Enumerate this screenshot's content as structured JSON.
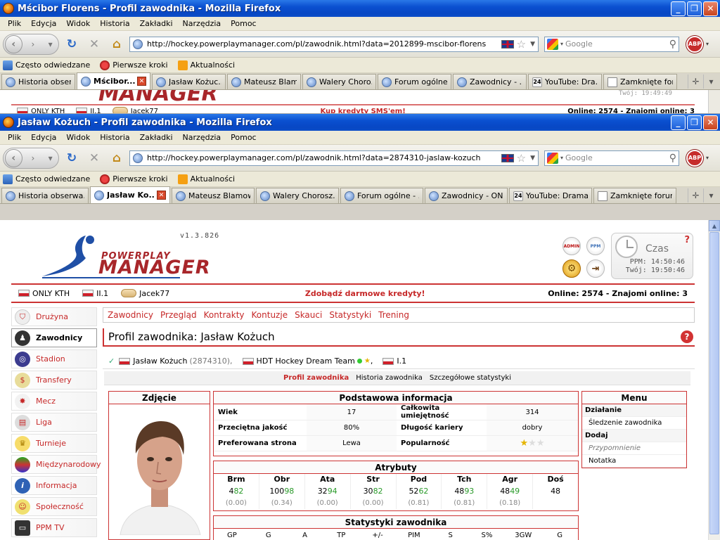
{
  "bg_window": {
    "title": "Mścibor Florens - Profil zawodnika - Mozilla Firefox",
    "url": "http://hockey.powerplaymanager.com/pl/zawodnik.html?data=2012899-mscibor-florens",
    "tabs": [
      "Historia obser...",
      "Mścibor...",
      "Jasław Kożuc...",
      "Mateusz Blam...",
      "Walery Choro...",
      "Forum ogólne...",
      "Zawodnicy - ...",
      "YouTube: Dra...",
      "Zamknięte for..."
    ],
    "strip": {
      "left1": "ONLY KTH",
      "left2": "II.1",
      "left3": "Jacek77",
      "mid": "Kup kredyty SMS'em!",
      "right": "Online: 2574 - Znajomi online: 3",
      "clock_fragment": "Twój: 19:49:49"
    }
  },
  "window": {
    "title": "Jasław Kożuch - Profil zawodnika - Mozilla Firefox",
    "menu": [
      "Plik",
      "Edycja",
      "Widok",
      "Historia",
      "Zakładki",
      "Narzędzia",
      "Pomoc"
    ],
    "url": "http://hockey.powerplaymanager.com/pl/zawodnik.html?data=2874310-jaslaw-kozuch",
    "search_placeholder": "Google",
    "bookmarks": [
      "Często odwiedzane",
      "Pierwsze kroki",
      "Aktualności"
    ],
    "tabs": [
      "Historia obserwa...",
      "Jasław Ko...",
      "Mateusz Blamow...",
      "Walery Chorosz...",
      "Forum ogólne - ...",
      "Zawodnicy - ON...",
      "YouTube: Drama...",
      "Zamknięte forum..."
    ]
  },
  "header": {
    "version": "v1.3.826",
    "logo_top": "POWERPLAY",
    "logo_bottom": "MANAGER",
    "admin_label": "ADMIN",
    "ppm_label": "PPM",
    "clock_title": "Czas",
    "ppm_time": "PPM:  14:50:46",
    "your_time": "Twój:  19:50:46"
  },
  "infobar": {
    "team1": "ONLY KTH",
    "league": "II.1",
    "user": "Jacek77",
    "promo": "Zdobądź darmowe kredyty!",
    "online": "Online: 2574 - Znajomi online: 3"
  },
  "sidebar": [
    "Drużyna",
    "Zawodnicy",
    "Stadion",
    "Transfery",
    "Mecz",
    "Liga",
    "Turnieje",
    "Międzynarodowy",
    "Informacja",
    "Społeczność",
    "PPM TV"
  ],
  "subnav": [
    "Zawodnicy",
    "Przegląd",
    "Kontrakty",
    "Kontuzje",
    "Skauci",
    "Statystyki",
    "Trening"
  ],
  "page_title": "Profil zawodnika: Jasław Kożuch",
  "player_line": {
    "name": "Jasław Kożuch",
    "id": "(2874310),",
    "team": "HDT Hockey Dream Team",
    "sep": ",",
    "league": "I.1"
  },
  "profile_tabs": [
    "Profil zawodnika",
    "Historia zawodnika",
    "Szczegółowe statystyki"
  ],
  "photo_title": "Zdjęcie",
  "basic": {
    "title": "Podstawowa informacja",
    "rows": [
      {
        "l1": "Wiek",
        "v1": "17",
        "l2": "Całkowita umiejętność",
        "v2": "314"
      },
      {
        "l1": "Przeciętna jakość",
        "v1": "80%",
        "l2": "Długość kariery",
        "v2": "dobry"
      },
      {
        "l1": "Preferowana strona",
        "v1": "Lewa",
        "l2": "Popularność",
        "v2": ""
      }
    ],
    "popularity_stars": 1,
    "popularity_max": 3
  },
  "menu": {
    "title": "Menu",
    "items": [
      {
        "label": "Działanie",
        "type": "section"
      },
      {
        "label": "Śledzenie zawodnika",
        "type": "link"
      },
      {
        "label": "Dodaj",
        "type": "section"
      },
      {
        "label": "Przypomnienie",
        "type": "disabled"
      },
      {
        "label": "Notatka",
        "type": "link"
      }
    ]
  },
  "attributes": {
    "title": "Atrybuty",
    "cols": [
      {
        "h": "Brm",
        "base": "4",
        "green": "82",
        "delta": "(0.00)"
      },
      {
        "h": "Obr",
        "base": "100",
        "green": "98",
        "delta": "(0.34)"
      },
      {
        "h": "Ata",
        "base": "32",
        "green": "94",
        "delta": "(0.00)"
      },
      {
        "h": "Str",
        "base": "30",
        "green": "82",
        "delta": "(0.00)"
      },
      {
        "h": "Pod",
        "base": "52",
        "green": "62",
        "delta": "(0.81)"
      },
      {
        "h": "Tch",
        "base": "48",
        "green": "93",
        "delta": "(0.81)"
      },
      {
        "h": "Agr",
        "base": "48",
        "green": "49",
        "delta": "(0.18)"
      },
      {
        "h": "Doś",
        "base": "48",
        "green": "",
        "delta": ""
      }
    ]
  },
  "stats": {
    "title": "Statystyki zawodnika",
    "headers": [
      "GP",
      "G",
      "A",
      "TP",
      "+/-",
      "PIM",
      "S",
      "S%",
      "3GW",
      "G"
    ]
  }
}
